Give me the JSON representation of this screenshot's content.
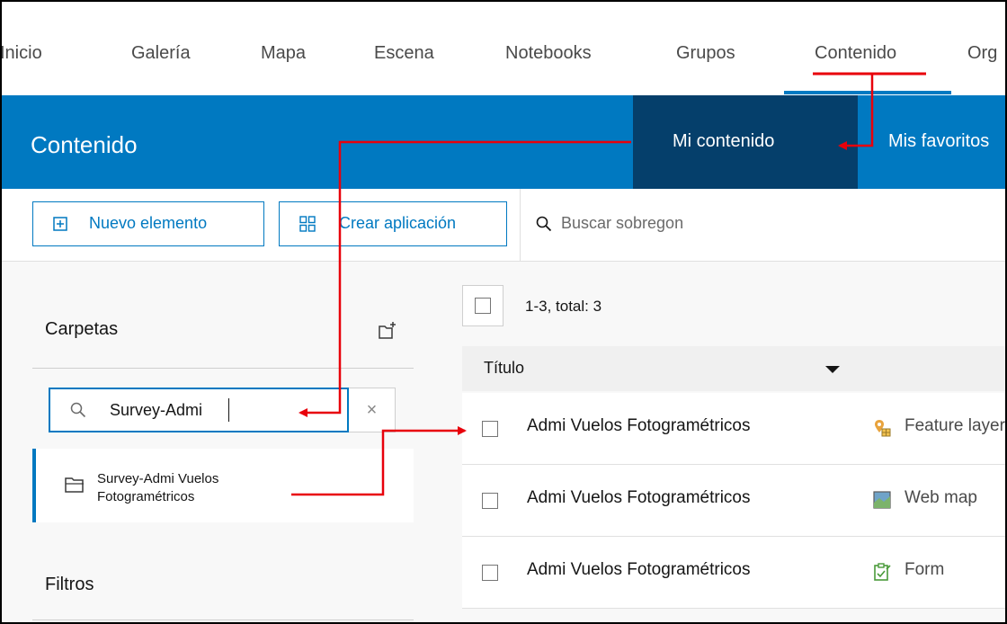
{
  "nav": {
    "items": [
      "Inicio",
      "Galería",
      "Mapa",
      "Escena",
      "Notebooks",
      "Grupos",
      "Contenido",
      "Org"
    ]
  },
  "header": {
    "title": "Contenido",
    "tab_mine": "Mi contenido",
    "tab_fav": "Mis favoritos"
  },
  "toolbar": {
    "new_item": "Nuevo elemento",
    "create_app": "Crear aplicación",
    "search_placeholder": "Buscar sobregon"
  },
  "sidebar": {
    "folders_label": "Carpetas",
    "folder_search_value": "Survey-Admi",
    "clear_symbol": "×",
    "folder_name": "Survey-Admi Vuelos Fotogramétricos",
    "filters_label": "Filtros"
  },
  "list": {
    "count": "1-3, total: 3",
    "column_title": "Título",
    "rows": [
      {
        "title": "Admi Vuelos Fotogramétricos",
        "type": "Feature layer",
        "icon": "feature-layer-icon"
      },
      {
        "title": "Admi Vuelos Fotogramétricos",
        "type": "Web map",
        "icon": "web-map-icon"
      },
      {
        "title": "Admi Vuelos Fotogramétricos",
        "type": "Form",
        "icon": "form-icon"
      }
    ]
  },
  "colors": {
    "accent": "#0079c1",
    "accent_dark": "#053f6b",
    "annotation": "#e8000b"
  }
}
